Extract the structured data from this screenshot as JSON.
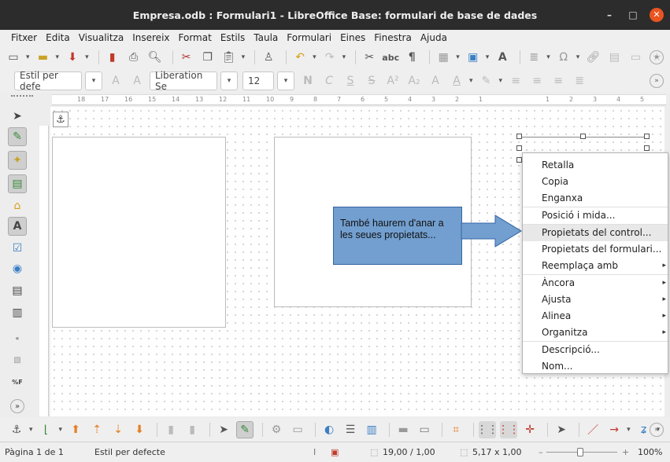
{
  "window": {
    "title": "Empresa.odb : Formulari1 - LibreOffice Base: formulari de base de dades",
    "minimize": "–",
    "maximize": "□",
    "close": "✕"
  },
  "menubar": [
    "Fitxer",
    "Edita",
    "Visualitza",
    "Insereix",
    "Format",
    "Estils",
    "Taula",
    "Formulari",
    "Eines",
    "Finestra",
    "Ajuda"
  ],
  "toolbar": {
    "paragraph_style": "Estil per defe",
    "font_name": "Liberation Se",
    "font_size": "12"
  },
  "ruler": {
    "horizontal_labels": [
      "18",
      "17",
      "16",
      "15",
      "14",
      "13",
      "12",
      "11",
      "10",
      "9",
      "8",
      "7",
      "6",
      "5",
      "4",
      "3",
      "2",
      "1",
      "1",
      "2",
      "3",
      "4",
      "5"
    ]
  },
  "callout": {
    "text": "També haurem d'anar a les seues propietats..."
  },
  "context_menu": {
    "items": [
      {
        "label": "Retalla",
        "submenu": false
      },
      {
        "label": "Copia",
        "submenu": false
      },
      {
        "label": "Enganxa",
        "submenu": false
      },
      {
        "label": "Posició i mida...",
        "submenu": false
      },
      {
        "label": "Propietats del control...",
        "submenu": false,
        "highlighted": true
      },
      {
        "label": "Propietats del formulari...",
        "submenu": false
      },
      {
        "label": "Reemplaça amb",
        "submenu": true
      },
      {
        "label": "Àncora",
        "submenu": true
      },
      {
        "label": "Ajusta",
        "submenu": true
      },
      {
        "label": "Alinea",
        "submenu": true
      },
      {
        "label": "Organitza",
        "submenu": true
      },
      {
        "label": "Descripció...",
        "submenu": false
      },
      {
        "label": "Nom...",
        "submenu": false
      }
    ]
  },
  "statusbar": {
    "page": "Pàgina 1 de 1",
    "style": "Estil per defecte",
    "position": "19,00 / 1,00",
    "size": "5,17 x 1,00",
    "zoom_level": "100%"
  },
  "colors": {
    "callout_fill": "#729fcf",
    "callout_border": "#3465a4",
    "close_button": "#e95420"
  }
}
